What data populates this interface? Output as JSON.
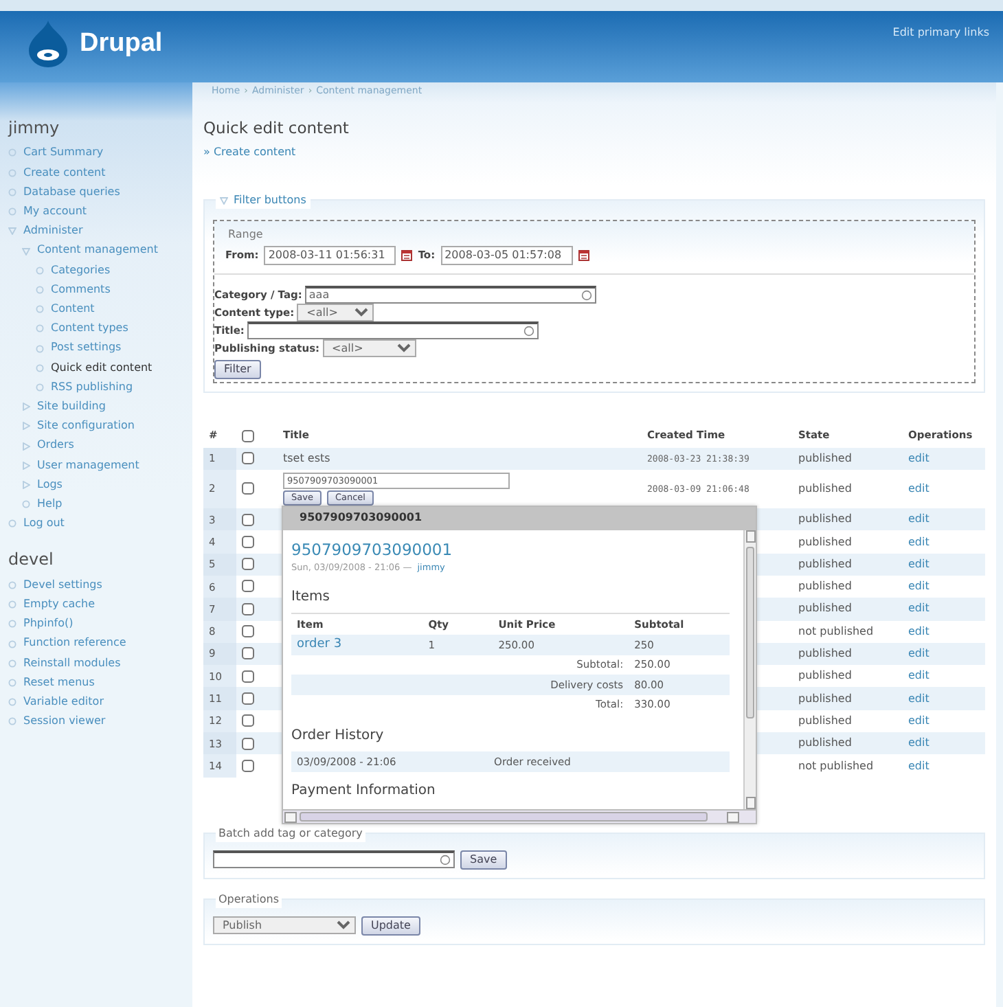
{
  "header": {
    "site_name": "Drupal",
    "primary_links": "Edit primary links"
  },
  "breadcrumb": {
    "separator": "›",
    "items": [
      "Home",
      "Administer",
      "Content management"
    ]
  },
  "page": {
    "title": "Quick edit content",
    "action_link": "» Create content"
  },
  "sidebar": {
    "blocks": [
      {
        "title": "jimmy",
        "items": [
          {
            "label": "Cart Summary",
            "kind": "leaf",
            "selected": false
          },
          {
            "label": "Create content",
            "kind": "leaf",
            "selected": false
          },
          {
            "label": "Database queries",
            "kind": "leaf",
            "selected": false
          },
          {
            "label": "My account",
            "kind": "leaf",
            "selected": false
          },
          {
            "label": "Administer",
            "kind": "expanded",
            "selected": false,
            "children": [
              {
                "label": "Content management",
                "kind": "expanded",
                "selected": false,
                "children": [
                  {
                    "label": "Categories",
                    "kind": "leaf",
                    "selected": false
                  },
                  {
                    "label": "Comments",
                    "kind": "leaf",
                    "selected": false
                  },
                  {
                    "label": "Content",
                    "kind": "leaf",
                    "selected": false
                  },
                  {
                    "label": "Content types",
                    "kind": "leaf",
                    "selected": false
                  },
                  {
                    "label": "Post settings",
                    "kind": "leaf",
                    "selected": false
                  },
                  {
                    "label": "Quick edit content",
                    "kind": "leaf",
                    "selected": true
                  },
                  {
                    "label": "RSS publishing",
                    "kind": "leaf",
                    "selected": false
                  }
                ]
              },
              {
                "label": "Site building",
                "kind": "collapsed",
                "selected": false
              },
              {
                "label": "Site configuration",
                "kind": "collapsed",
                "selected": false
              },
              {
                "label": "Orders",
                "kind": "collapsed",
                "selected": false
              },
              {
                "label": "User management",
                "kind": "collapsed",
                "selected": false
              },
              {
                "label": "Logs",
                "kind": "collapsed",
                "selected": false
              },
              {
                "label": "Help",
                "kind": "leaf",
                "selected": false
              }
            ]
          },
          {
            "label": "Log out",
            "kind": "leaf",
            "selected": false
          }
        ]
      },
      {
        "title": "devel",
        "items": [
          {
            "label": "Devel settings",
            "kind": "leaf",
            "selected": false
          },
          {
            "label": "Empty cache",
            "kind": "leaf",
            "selected": false
          },
          {
            "label": "Phpinfo()",
            "kind": "leaf",
            "selected": false
          },
          {
            "label": "Function reference",
            "kind": "leaf",
            "selected": false
          },
          {
            "label": "Reinstall modules",
            "kind": "leaf",
            "selected": false
          },
          {
            "label": "Reset menus",
            "kind": "leaf",
            "selected": false
          },
          {
            "label": "Variable editor",
            "kind": "leaf",
            "selected": false
          },
          {
            "label": "Session viewer",
            "kind": "leaf",
            "selected": false
          }
        ]
      }
    ]
  },
  "filter": {
    "legend": "Filter buttons",
    "expanded": true,
    "range": {
      "legend": "Range",
      "from_label": "From:",
      "from_value": "2008-03-11 01:56:31",
      "to_label": "To:",
      "to_value": "2008-03-05 01:57:08"
    },
    "category_label": "Category / Tag:",
    "category_value": "aaa",
    "content_type_label": "Content type:",
    "content_type_value": "<all>",
    "title_label": "Title:",
    "status_label": "Publishing status:",
    "status_value": "<all>",
    "button": "Filter"
  },
  "table": {
    "columns": [
      "#",
      "Title",
      "Created Time",
      "State",
      "Operations"
    ],
    "select_all_checked": false,
    "rows": [
      {
        "number": "1",
        "checked": false,
        "kind": "plain",
        "title": "tset ests",
        "created": "2008-03-23 21:38:39",
        "state": "published",
        "operation": "edit"
      },
      {
        "number": "2",
        "checked": false,
        "kind": "editing",
        "title": "9507909703090001",
        "save": "Save",
        "cancel": "Cancel",
        "created": "2008-03-09 21:06:48",
        "state": "published",
        "operation": "edit"
      },
      {
        "number": "3",
        "checked": false,
        "kind": "covered",
        "state": "published",
        "operation": "edit"
      },
      {
        "number": "4",
        "checked": false,
        "kind": "covered",
        "state": "published",
        "operation": "edit"
      },
      {
        "number": "5",
        "checked": false,
        "kind": "covered",
        "state": "published",
        "operation": "edit"
      },
      {
        "number": "6",
        "checked": false,
        "kind": "covered",
        "state": "published",
        "operation": "edit"
      },
      {
        "number": "7",
        "checked": false,
        "kind": "covered",
        "state": "published",
        "operation": "edit"
      },
      {
        "number": "8",
        "checked": false,
        "kind": "covered",
        "state": "not published",
        "operation": "edit"
      },
      {
        "number": "9",
        "checked": false,
        "kind": "covered",
        "state": "published",
        "operation": "edit"
      },
      {
        "number": "10",
        "checked": false,
        "kind": "covered",
        "state": "published",
        "operation": "edit"
      },
      {
        "number": "11",
        "checked": false,
        "kind": "covered",
        "state": "published",
        "operation": "edit"
      },
      {
        "number": "12",
        "checked": false,
        "kind": "covered",
        "state": "published",
        "operation": "edit"
      },
      {
        "number": "13",
        "checked": false,
        "kind": "covered",
        "state": "published",
        "operation": "edit"
      },
      {
        "number": "14",
        "checked": false,
        "kind": "covered",
        "state": "not published",
        "operation": "edit"
      }
    ]
  },
  "popup": {
    "title": "9507909703090001",
    "heading": "9507909703090001",
    "meta": "Sun, 03/09/2008 - 21:06 —",
    "author": "jimmy",
    "items_heading": "Items",
    "items_columns": [
      "Item",
      "Qty",
      "Unit Price",
      "Subtotal"
    ],
    "items_rows": [
      {
        "item": "order 3",
        "qty": "1",
        "unit_price": "250.00",
        "subtotal": "250"
      }
    ],
    "totals": [
      {
        "label": "Subtotal:",
        "value": "250.00"
      },
      {
        "label": "Delivery costs",
        "value": "80.00"
      },
      {
        "label": "Total:",
        "value": "330.00"
      }
    ],
    "history_heading": "Order History",
    "history": [
      {
        "date": "03/09/2008 - 21:06",
        "status": "Order received"
      }
    ],
    "payment_heading": "Payment Information"
  },
  "batch": {
    "legend": "Batch add tag or category",
    "button": "Save"
  },
  "operations": {
    "legend": "Operations",
    "value": "Publish",
    "button": "Update"
  }
}
